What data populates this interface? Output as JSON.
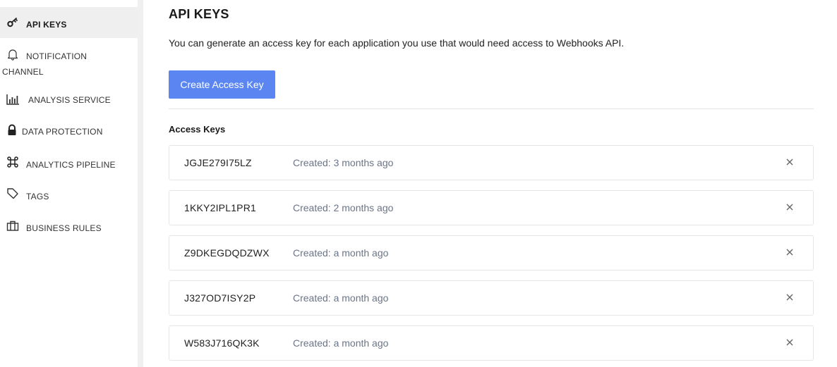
{
  "sidebar": {
    "items": [
      {
        "label": "API KEYS",
        "icon": "key-icon",
        "active": true
      },
      {
        "label": "NOTIFICATION",
        "label_line2": "CHANNEL",
        "icon": "bell-icon",
        "active": false
      },
      {
        "label": "ANALYSIS SERVICE",
        "icon": "bar-chart-icon",
        "active": false
      },
      {
        "label": "DATA PROTECTION",
        "icon": "lock-icon",
        "active": false
      },
      {
        "label": "ANALYTICS PIPELINE",
        "icon": "command-icon",
        "active": false
      },
      {
        "label": "TAGS",
        "icon": "tag-icon",
        "active": false
      },
      {
        "label": "BUSINESS RULES",
        "icon": "briefcase-icon",
        "active": false
      }
    ]
  },
  "main": {
    "title": "API KEYS",
    "description": "You can generate an access key for each application you use that would need access to Webhooks API.",
    "create_button_label": "Create Access Key",
    "section_title": "Access Keys",
    "keys": [
      {
        "id": "JGJE279I75LZ",
        "created": "Created: 3 months ago"
      },
      {
        "id": "1KKY2IPL1PR1",
        "created": "Created: 2 months ago"
      },
      {
        "id": "Z9DKEGDQDZWX",
        "created": "Created: a month ago"
      },
      {
        "id": "J327OD7ISY2P",
        "created": "Created: a month ago"
      },
      {
        "id": "W583J716QK3K",
        "created": "Created: a month ago"
      }
    ]
  },
  "colors": {
    "accent": "#5b86f1",
    "muted_text": "#6b7487",
    "active_nav_bg": "#efefef"
  }
}
